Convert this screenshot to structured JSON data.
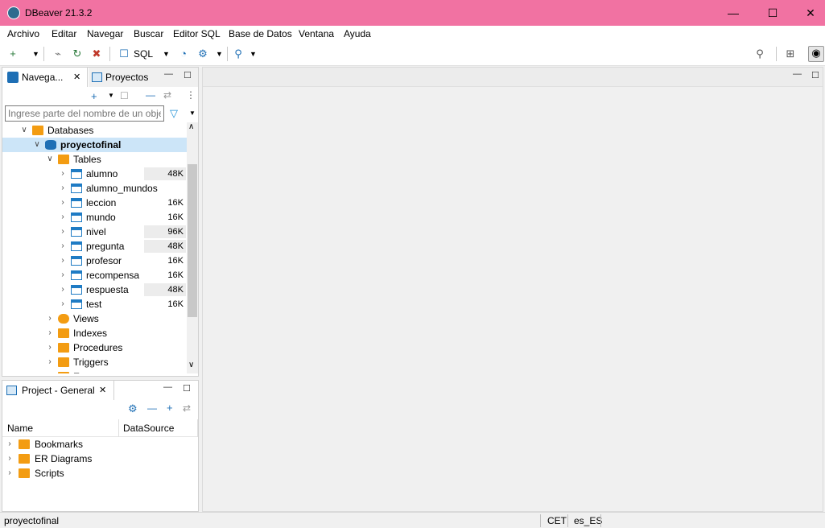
{
  "window": {
    "title": "DBeaver 21.3.2",
    "minimize": "—",
    "maximize": "☐",
    "close": "✕"
  },
  "menu": [
    "Archivo",
    "Editar",
    "Navegar",
    "Buscar",
    "Editor SQL",
    "Base de Datos",
    "Ventana",
    "Ayuda"
  ],
  "toolbar": {
    "sql_label": "SQL"
  },
  "navigator": {
    "tabs": [
      {
        "label": "Navega...",
        "close": "✕"
      },
      {
        "label": "Proyectos"
      }
    ],
    "filter_placeholder": "Ingrese parte del nombre de un obje",
    "tree": {
      "root": "Databases",
      "connection": "proyectofinal",
      "tables_folder": "Tables",
      "tables": [
        {
          "name": "alumno",
          "size": "48K",
          "highlight": true
        },
        {
          "name": "alumno_mundos",
          "size": "",
          "highlight": false
        },
        {
          "name": "leccion",
          "size": "16K",
          "highlight": false
        },
        {
          "name": "mundo",
          "size": "16K",
          "highlight": false
        },
        {
          "name": "nivel",
          "size": "96K",
          "highlight": true
        },
        {
          "name": "pregunta",
          "size": "48K",
          "highlight": true
        },
        {
          "name": "profesor",
          "size": "16K",
          "highlight": false
        },
        {
          "name": "recompensa",
          "size": "16K",
          "highlight": false
        },
        {
          "name": "respuesta",
          "size": "48K",
          "highlight": true
        },
        {
          "name": "test",
          "size": "16K",
          "highlight": false
        }
      ],
      "folders": [
        "Views",
        "Indexes",
        "Procedures",
        "Triggers",
        "Events"
      ]
    }
  },
  "project": {
    "tab": {
      "label": "Project - General",
      "close": "✕"
    },
    "columns": [
      "Name",
      "DataSource"
    ],
    "items": [
      "Bookmarks",
      "ER Diagrams",
      "Scripts"
    ]
  },
  "status": {
    "connection": "proyectofinal",
    "timezone": "CET",
    "locale": "es_ES"
  }
}
